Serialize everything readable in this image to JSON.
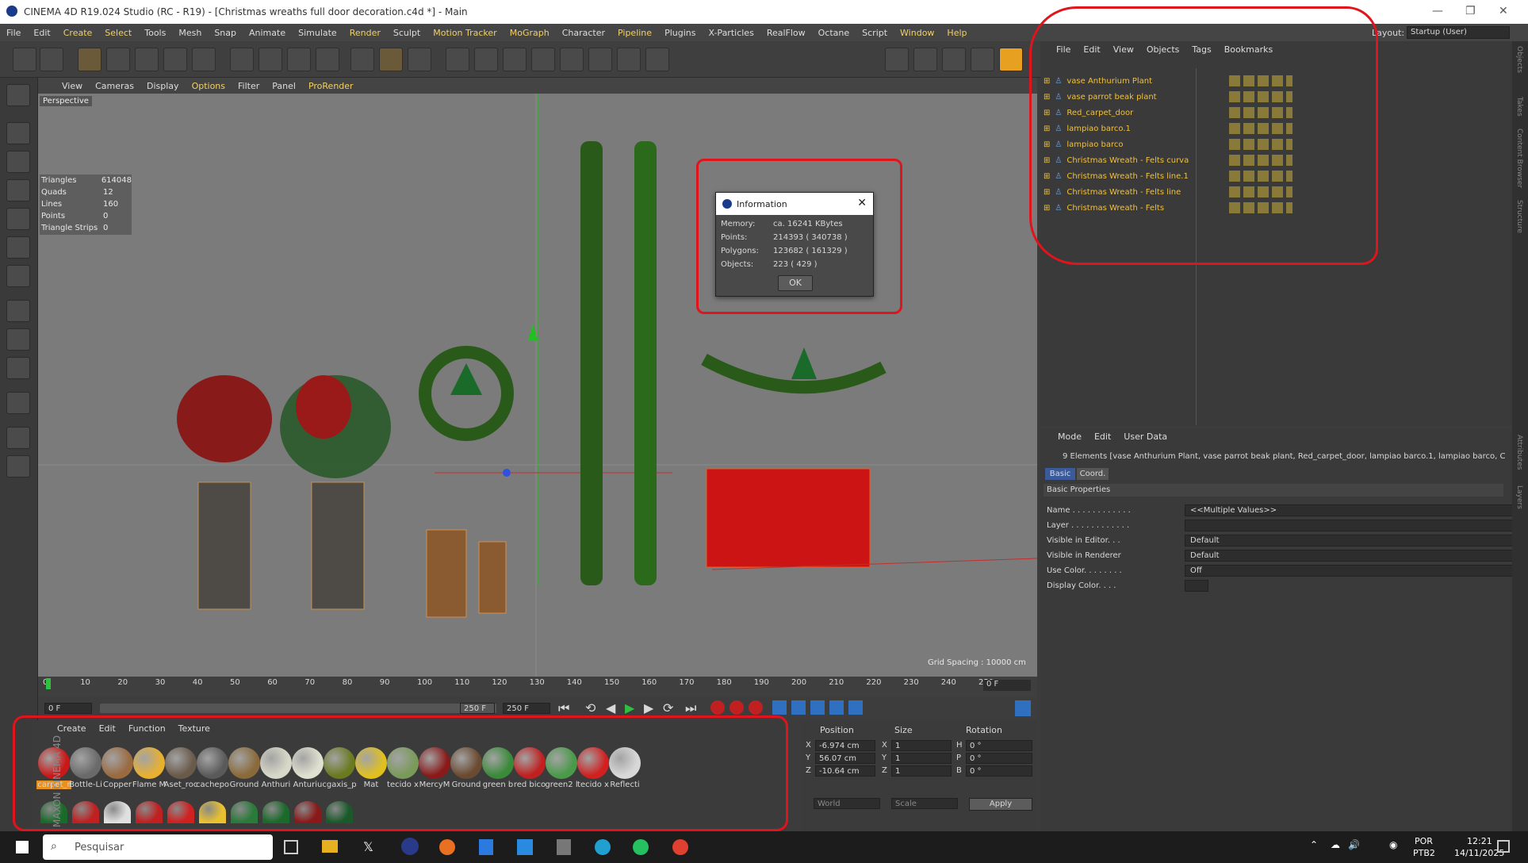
{
  "window": {
    "title": "CINEMA 4D R19.024 Studio (RC - R19) - [Christmas wreaths full door decoration.c4d *] - Main"
  },
  "menu": [
    "File",
    "Edit",
    "Create",
    "Select",
    "Tools",
    "Mesh",
    "Snap",
    "Animate",
    "Simulate",
    "Render",
    "Sculpt",
    "Motion Tracker",
    "MoGraph",
    "Character",
    "Pipeline",
    "Plugins",
    "X-Particles",
    "RealFlow",
    "Octane",
    "Script",
    "Window",
    "Help"
  ],
  "layout": {
    "label": "Layout:",
    "value": "Startup (User)"
  },
  "viewport": {
    "menu": [
      "View",
      "Cameras",
      "Display",
      "Options",
      "Filter",
      "Panel",
      "ProRender"
    ],
    "camera": "Perspective",
    "grid_spacing": "Grid Spacing : 10000 cm",
    "stats": [
      {
        "k": "Triangles",
        "v": "614048"
      },
      {
        "k": "Quads",
        "v": "12"
      },
      {
        "k": "Lines",
        "v": "160"
      },
      {
        "k": "Points",
        "v": "0"
      },
      {
        "k": "Triangle Strips",
        "v": "0"
      }
    ]
  },
  "info_dialog": {
    "title": "Information",
    "rows": [
      {
        "k": "Memory:",
        "v": "ca. 16241 KBytes"
      },
      {
        "k": "Points:",
        "v": "214393 ( 340738 )"
      },
      {
        "k": "Polygons:",
        "v": "123682 ( 161329 )"
      },
      {
        "k": "Objects:",
        "v": "223 ( 429 )"
      }
    ],
    "ok": "OK"
  },
  "timeline": {
    "ticks": [
      "0",
      "10",
      "20",
      "30",
      "40",
      "50",
      "60",
      "70",
      "80",
      "90",
      "100",
      "110",
      "120",
      "130",
      "140",
      "150",
      "160",
      "170",
      "180",
      "190",
      "200",
      "210",
      "220",
      "230",
      "240",
      "250"
    ],
    "frame": "0 F",
    "start": "0 F",
    "range_end": "250 F",
    "end": "250 F"
  },
  "materials": {
    "menu": [
      "Create",
      "Edit",
      "Function",
      "Texture"
    ],
    "row1": [
      "carpet_r",
      "Bottle-Li",
      "Copper",
      "Flame M",
      "Aset_roc",
      "cachepo",
      "Ground",
      "Anthuri",
      "Anturiu",
      "cgaxis_p",
      "Mat",
      "tecido x",
      "MercyM",
      "Ground",
      "green b",
      "red bico",
      "green2 l",
      "tecido x",
      "Reflecti"
    ],
    "brand": "MAXON CINEMA 4D"
  },
  "coords": {
    "headers": [
      "Position",
      "Size",
      "Rotation"
    ],
    "rows": [
      {
        "a": "X",
        "p": "-6.974 cm",
        "s": "1",
        "r": "H",
        "rv": "0 °"
      },
      {
        "a": "Y",
        "p": "56.07 cm",
        "s": "1",
        "r": "P",
        "rv": "0 °"
      },
      {
        "a": "Z",
        "p": "-10.64 cm",
        "s": "1",
        "r": "B",
        "rv": "0 °"
      }
    ],
    "world": "World",
    "scale": "Scale",
    "apply": "Apply"
  },
  "objects": {
    "menu": [
      "File",
      "Edit",
      "View",
      "Objects",
      "Tags",
      "Bookmarks"
    ],
    "items": [
      "vase  Anthurium Plant",
      "vase parrot beak plant",
      "Red_carpet_door",
      "lampiao barco.1",
      "lampiao barco",
      "Christmas Wreath - Felts curva",
      "Christmas Wreath - Felts line.1",
      "Christmas Wreath - Felts line",
      "Christmas Wreath - Felts"
    ]
  },
  "attributes": {
    "menu": [
      "Mode",
      "Edit",
      "User Data"
    ],
    "selection": "9 Elements [vase  Anthurium Plant, vase parrot beak plant, Red_carpet_door, lampiao barco.1, lampiao barco, C",
    "tabs": [
      "Basic",
      "Coord."
    ],
    "section": "Basic Properties",
    "rows": [
      {
        "k": "Name . . . . . . . . . . . .",
        "v": "<<Multiple Values>>"
      },
      {
        "k": "Layer . . . . . . . . . . . .",
        "v": ""
      },
      {
        "k": "Visible in Editor. . .",
        "v": "Default"
      },
      {
        "k": "Visible in Renderer",
        "v": "Default"
      },
      {
        "k": "Use Color. . . . . . . .",
        "v": "Off"
      },
      {
        "k": "Display Color. . . .",
        "v": ""
      }
    ]
  },
  "right_tabs": [
    "Objects",
    "Takes",
    "Content Browser",
    "Structure",
    "Attributes",
    "Layers"
  ],
  "taskbar": {
    "search": "Pesquisar",
    "lang1": "POR",
    "lang2": "PTB2",
    "time": "12:21",
    "date": "14/11/2025"
  }
}
